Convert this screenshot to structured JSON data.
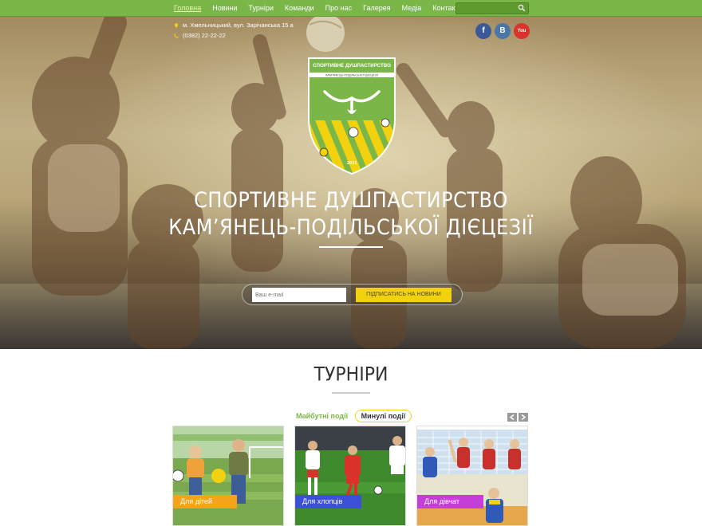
{
  "nav": {
    "items": [
      {
        "label": "Головна",
        "active": true
      },
      {
        "label": "Новини"
      },
      {
        "label": "Турніри"
      },
      {
        "label": "Команди"
      },
      {
        "label": "Про нас"
      },
      {
        "label": "Галерея"
      },
      {
        "label": "Медіа"
      },
      {
        "label": "Контакти"
      }
    ],
    "search_placeholder": "",
    "search_icon": "search-icon"
  },
  "hero": {
    "address": "м. Хмельницький, вул. Зарічанська 15 а",
    "phone": "(0382) 22-22-22",
    "social": [
      {
        "label": "f",
        "icon": "facebook-icon",
        "color": "#3b5998"
      },
      {
        "label": "B",
        "icon": "vk-icon",
        "color": "#4a76a8"
      },
      {
        "label": "You",
        "icon": "youtube-icon",
        "color": "#d9332b"
      }
    ],
    "crest": {
      "top_text": "СПОРТИВНЕ ДУШПАСТИРСТВО",
      "sub_text": "КАМ'ЯНЕЦЬ-ПОДІЛЬСЬКОЇ ДІЄЦЕЗІЇ",
      "year": "2011"
    },
    "title_line1": "СПОРТИВНЕ ДУШПАСТИРСТВО",
    "title_line2": "КАМ’ЯНЕЦЬ-ПОДІЛЬСЬКОЇ ДІЄЦЕЗІЇ",
    "email_placeholder": "Ваш e-mail",
    "subscribe_label": "ПІДПИСАТИСЬ НА НОВИНИ"
  },
  "tournaments": {
    "title": "ТУРНІРИ",
    "tab_upcoming": "Майбутні події",
    "tab_past": "Минулі події",
    "cards": [
      {
        "label": "Для дітей",
        "color": "#f5a31a"
      },
      {
        "label": "Для хлопців",
        "color": "#3b4fd8"
      },
      {
        "label": "Для дівчат",
        "color": "#c43fd9"
      }
    ]
  },
  "colors": {
    "nav_green": "#7ab648",
    "accent_yellow": "#f2d20f"
  }
}
